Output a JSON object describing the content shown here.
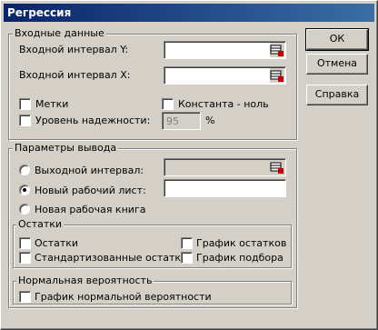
{
  "window": {
    "title": "Регрессия"
  },
  "input_group": {
    "legend": "Входные данные",
    "y_range_label": "Входной интервал Y:",
    "x_range_label": "Входной интервал X:",
    "labels_checkbox": "Метки",
    "constant_zero_checkbox": "Константа - ноль",
    "confidence_checkbox": "Уровень надежности:",
    "confidence_value": "95",
    "percent": "%"
  },
  "output_group": {
    "legend": "Параметры вывода",
    "output_range_radio": "Выходной интервал:",
    "new_sheet_radio": "Новый рабочий лист:",
    "new_workbook_radio": "Новая рабочая книга",
    "selected": "new_sheet"
  },
  "residuals_group": {
    "legend": "Остатки",
    "residuals": "Остатки",
    "standardized_residuals": "Стандартизованные остатки",
    "residual_plots": "График остатков",
    "line_fit_plots": "График подбора"
  },
  "normal_group": {
    "legend": "Нормальная вероятность",
    "normal_probability_plots": "График нормальной вероятности"
  },
  "buttons": {
    "ok": "ОК",
    "cancel": "Отмена",
    "help": "Справка"
  },
  "icons": {
    "range_select": "range-select-icon"
  }
}
